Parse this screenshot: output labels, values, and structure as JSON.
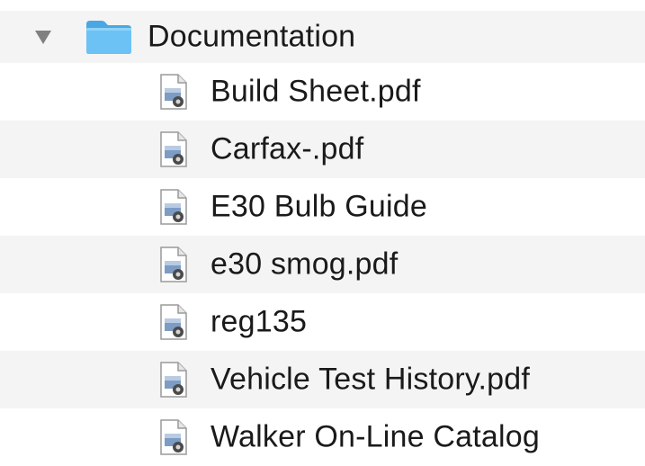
{
  "folder": {
    "name": "Documentation",
    "expanded": true,
    "icon": "folder-icon",
    "color": "#5ab8f0"
  },
  "files": [
    {
      "name": "Build Sheet.pdf",
      "icon": "document-icon"
    },
    {
      "name": "Carfax-.pdf",
      "icon": "document-icon"
    },
    {
      "name": "E30 Bulb Guide",
      "icon": "document-icon"
    },
    {
      "name": "e30 smog.pdf",
      "icon": "document-icon"
    },
    {
      "name": "reg135",
      "icon": "document-icon"
    },
    {
      "name": "Vehicle Test History.pdf",
      "icon": "document-icon"
    },
    {
      "name": "Walker On-Line Catalog",
      "icon": "document-icon"
    }
  ],
  "colors": {
    "alternate_row": "#f4f4f4",
    "disclosure": "#808080"
  }
}
